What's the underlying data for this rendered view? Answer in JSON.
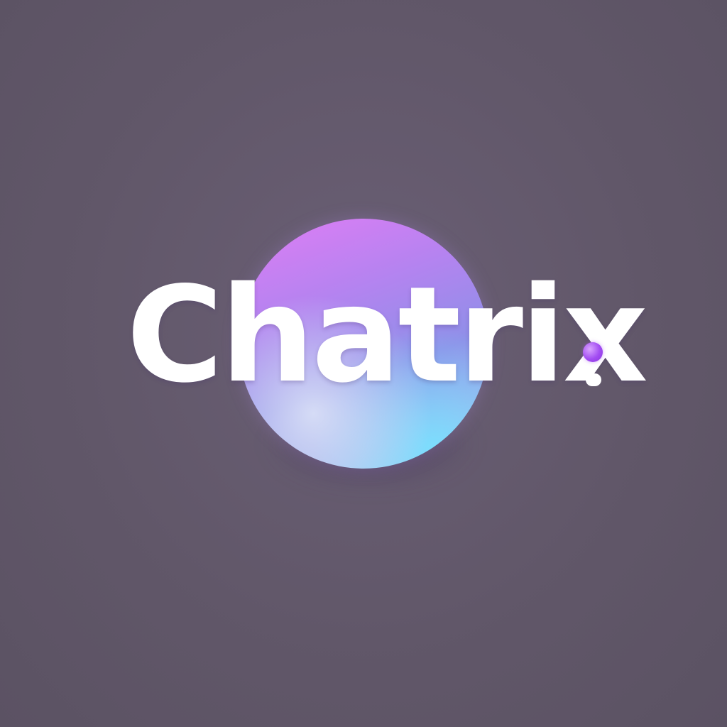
{
  "logo": {
    "wordmark": "Chatrix",
    "orb_gradient_colors": [
      "#e07df5",
      "#8f8fe8",
      "#9ad7f4"
    ],
    "accent_dot_color": "#a24cf2",
    "text_color": "#ffffff",
    "background_color": "#615769"
  }
}
